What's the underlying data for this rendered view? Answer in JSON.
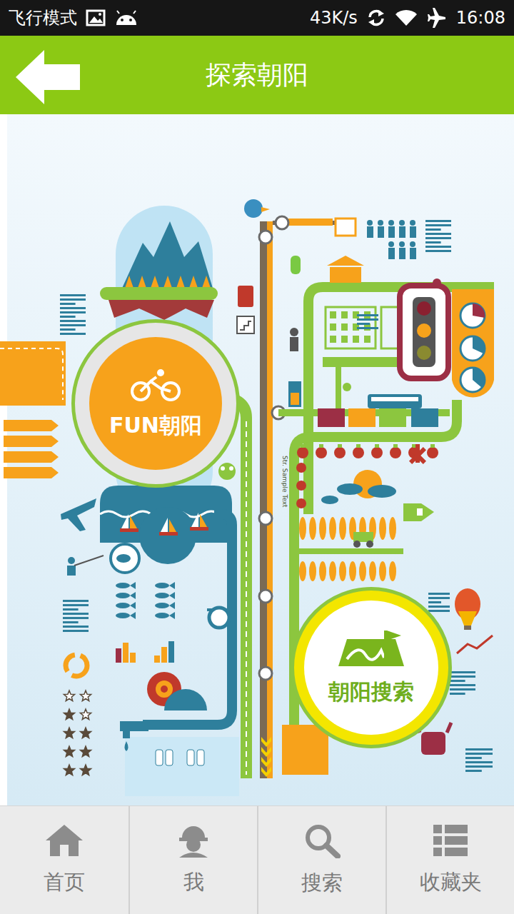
{
  "status_bar": {
    "mode": "飞行模式",
    "speed": "43K/s",
    "time": "16:08"
  },
  "header": {
    "title": "探索朝阳"
  },
  "map": {
    "hubs": [
      {
        "label": "FUN朝阳",
        "color": "#f7a21b"
      },
      {
        "label": "朝阳搜索",
        "color": "#ffffff"
      }
    ],
    "labels": [
      "Str. Sample Text"
    ]
  },
  "nav": {
    "items": [
      {
        "label": "首页",
        "selected": false
      },
      {
        "label": "我",
        "selected": false
      },
      {
        "label": "搜索",
        "selected": false
      },
      {
        "label": "收藏夹",
        "selected": false
      }
    ]
  }
}
